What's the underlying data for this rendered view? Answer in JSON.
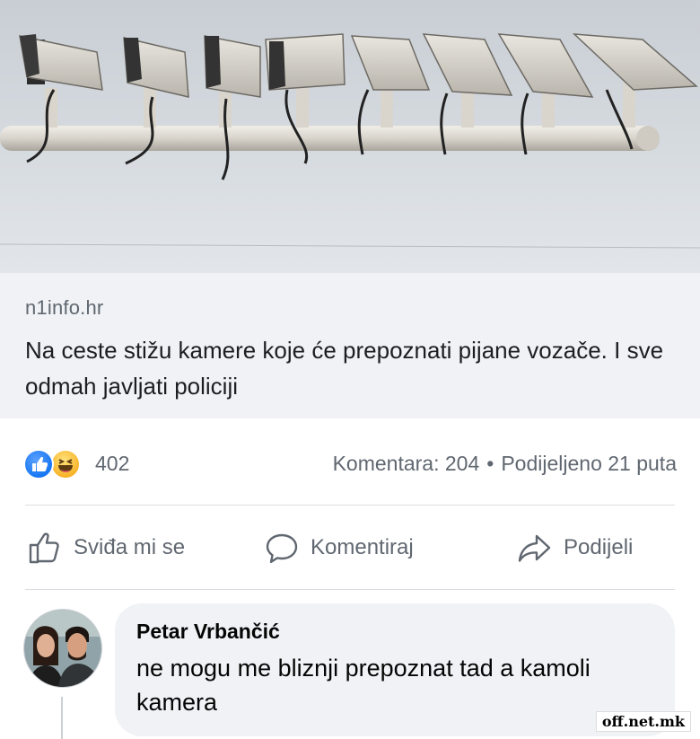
{
  "link_preview": {
    "image_icon": "surveillance-cameras-photo",
    "domain": "n1info.hr",
    "title": "Na ceste stižu kamere koje će prepoznati pijane vozače. I sve odmah javljati policiji"
  },
  "stats": {
    "reaction_icons": [
      "like-reaction-icon",
      "haha-reaction-icon"
    ],
    "reaction_count": "402",
    "comments": "Komentara: 204",
    "separator": "•",
    "shares": "Podijeljeno 21 puta"
  },
  "actions": {
    "like": {
      "label": "Sviđa mi se",
      "icon": "thumbs-up-icon"
    },
    "comment": {
      "label": "Komentiraj",
      "icon": "speech-bubble-icon"
    },
    "share": {
      "label": "Podijeli",
      "icon": "share-arrow-icon"
    }
  },
  "comment": {
    "author": "Petar Vrbančić",
    "text": "ne mogu me bliznji prepoznat tad a kamoli kamera"
  },
  "watermark": "off.net.mk",
  "colors": {
    "like_blue": "#1877f2",
    "haha_yellow": "#f7b125",
    "secondary_text": "#606770",
    "bubble_bg": "#f0f2f5"
  }
}
